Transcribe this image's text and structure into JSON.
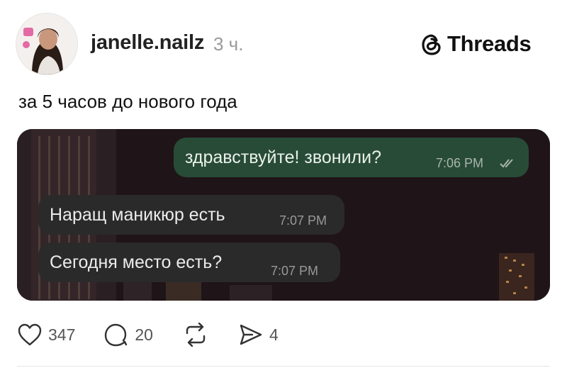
{
  "post": {
    "username": "janelle.nailz",
    "time_ago": "3 ч.",
    "badge_label": "Threads",
    "text": "за 5 часов до нового года"
  },
  "chat": {
    "messages": [
      {
        "direction": "outgoing",
        "text": "здравствуйте! звонили?",
        "time": "7:06 PM",
        "read_status": "double-check-icon"
      },
      {
        "direction": "incoming",
        "text": "Наращ маникюр есть",
        "time": "7:07 PM"
      },
      {
        "direction": "incoming",
        "text": "Сегодня место есть?",
        "time": "7:07 PM"
      }
    ]
  },
  "actions": {
    "likes": "347",
    "comments": "20",
    "shares": "4"
  },
  "colors": {
    "outgoing_bubble": "#284b37",
    "incoming_bubble": "#2b2a2b",
    "media_background": "#1e1317"
  }
}
